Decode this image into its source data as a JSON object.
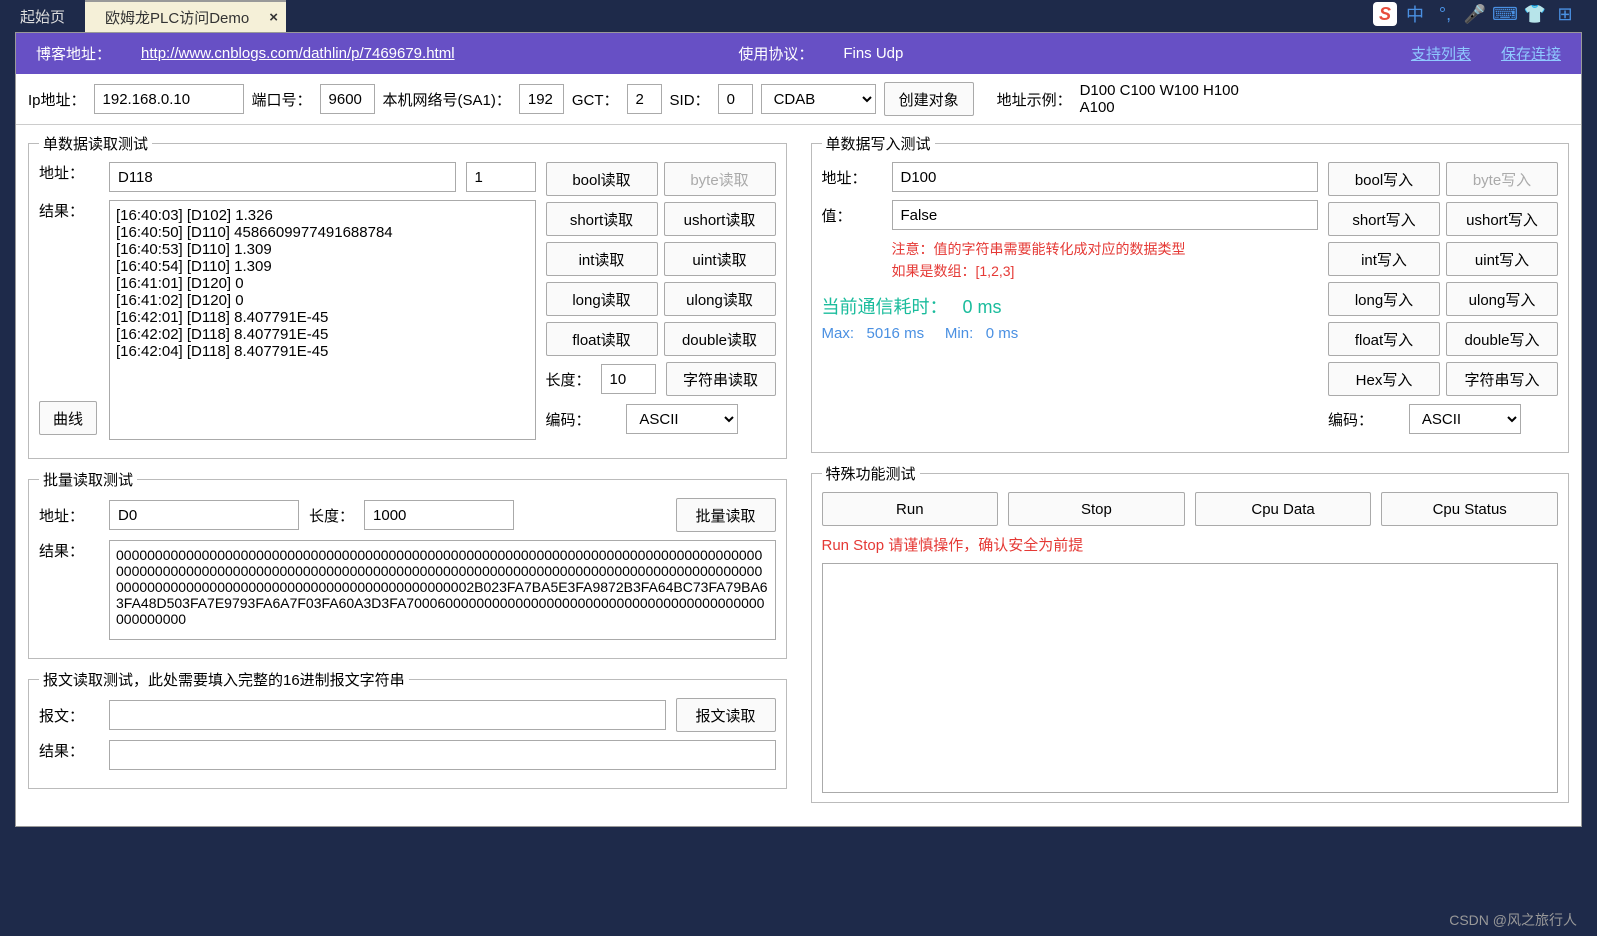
{
  "tabs": {
    "start": "起始页",
    "active": "欧姆龙PLC访问Demo",
    "close": "×"
  },
  "ime": {
    "s": "S",
    "zhong": "中"
  },
  "header": {
    "blog_label": "博客地址：",
    "blog_url": "http://www.cnblogs.com/dathlin/p/7469679.html",
    "proto_label": "使用协议：",
    "proto_value": "Fins Udp",
    "support_link": "支持列表",
    "save_link": "保存连接"
  },
  "conn": {
    "ip_label": "Ip地址：",
    "ip_value": "192.168.0.10",
    "port_label": "端口号：",
    "port_value": "9600",
    "sa1_label": "本机网络号(SA1)：",
    "sa1_value": "192",
    "gct_label": "GCT：",
    "gct_value": "2",
    "sid_label": "SID：",
    "sid_value": "0",
    "byte_order": "CDAB",
    "create_btn": "创建对象",
    "sample_label": "地址示例：",
    "sample_value": "D100 C100 W100 H100 A100"
  },
  "read": {
    "legend": "单数据读取测试",
    "addr_label": "地址：",
    "addr_value": "D118",
    "count_value": "1",
    "result_label": "结果：",
    "log": "[16:40:03] [D102] 1.326\n[16:40:50] [D110] 4586609977491688784\n[16:40:53] [D110] 1.309\n[16:40:54] [D110] 1.309\n[16:41:01] [D120] 0\n[16:41:02] [D120] 0\n[16:42:01] [D118] 8.407791E-45\n[16:42:02] [D118] 8.407791E-45\n[16:42:04] [D118] 8.407791E-45",
    "curve_btn": "曲线",
    "btns": {
      "bool": "bool读取",
      "byte": "byte读取",
      "short": "short读取",
      "ushort": "ushort读取",
      "int": "int读取",
      "uint": "uint读取",
      "long": "long读取",
      "ulong": "ulong读取",
      "float": "float读取",
      "double": "double读取",
      "string": "字符串读取"
    },
    "len_label": "长度：",
    "len_value": "10",
    "enc_label": "编码：",
    "enc_value": "ASCII"
  },
  "write": {
    "legend": "单数据写入测试",
    "addr_label": "地址：",
    "addr_value": "D100",
    "val_label": "值：",
    "val_value": "False",
    "note": "注意：值的字符串需要能转化成对应的数据类型\n如果是数组：[1,2,3]",
    "btns": {
      "bool": "bool写入",
      "byte": "byte写入",
      "short": "short写入",
      "ushort": "ushort写入",
      "int": "int写入",
      "uint": "uint写入",
      "long": "long写入",
      "ulong": "ulong写入",
      "float": "float写入",
      "double": "double写入",
      "hex": "Hex写入",
      "string": "字符串写入"
    },
    "enc_label": "编码：",
    "enc_value": "ASCII",
    "time_label": "当前通信耗时：",
    "time_value": "0 ms",
    "max_label": "Max:",
    "max_value": "5016 ms",
    "min_label": "Min:",
    "min_value": "0 ms"
  },
  "batch": {
    "legend": "批量读取测试",
    "addr_label": "地址：",
    "addr_value": "D0",
    "len_label": "长度：",
    "len_value": "1000",
    "btn": "批量读取",
    "result_label": "结果：",
    "result": "00000000000000000000000000000000000000000000000000000000000000000000000000000000000000000000000000000000000000000000000000000000000000000000000000000000000000000000000000000000000000000000000000000000000000000002B023FA7BA5E3FA9872B3FA64BC73FA79BA63FA48D503FA7E9793FA6A7F03FA60A3D3FA7000600000000000000000000000000000000000000000000000000"
  },
  "msg": {
    "legend": "报文读取测试，此处需要填入完整的16进制报文字符串",
    "msg_label": "报文：",
    "btn": "报文读取",
    "result_label": "结果："
  },
  "special": {
    "legend": "特殊功能测试",
    "run": "Run",
    "stop": "Stop",
    "cpu_data": "Cpu Data",
    "cpu_status": "Cpu Status",
    "warn": "Run Stop 请谨慎操作，确认安全为前提"
  },
  "watermark": "CSDN @风之旅行人"
}
